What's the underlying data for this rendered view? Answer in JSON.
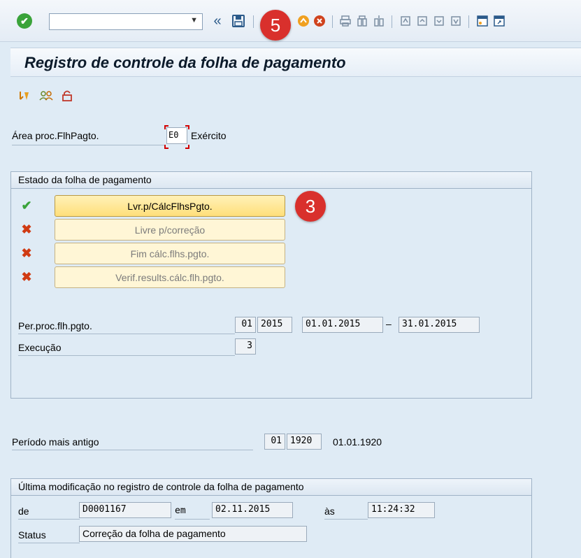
{
  "toolbar": {
    "ok_icon": "✔",
    "command_value": "",
    "dropdown_icon": "▼",
    "back_icon": "«",
    "save_icon": "💾",
    "badge": "5"
  },
  "title": "Registro de controle da folha de pagamento",
  "area": {
    "label": "Área proc.FlhPagto.",
    "value": "E0",
    "text": "Exército"
  },
  "status_group": {
    "title": "Estado da folha de pagamento",
    "badge": "3",
    "buttons": [
      {
        "label": "Lvr.p/CálcFlhsPgto.",
        "state": "ok"
      },
      {
        "label": "Livre p/correção",
        "state": "no"
      },
      {
        "label": "Fim cálc.flhs.pgto.",
        "state": "no"
      },
      {
        "label": "Verif.results.cálc.flh.pgto.",
        "state": "no"
      }
    ],
    "period_label": "Per.proc.flh.pgto.",
    "period_month": "01",
    "period_year": "2015",
    "period_from": "01.01.2015",
    "period_dash": "–",
    "period_to": "31.01.2015",
    "execution_label": "Execução",
    "execution_value": "3"
  },
  "oldest": {
    "label": "Período mais antigo",
    "month": "01",
    "year": "1920",
    "date": "01.01.1920"
  },
  "last_change": {
    "title": "Última modificação no registro de controle da folha de pagamento",
    "de_label": "de",
    "user": "D0001167",
    "em_label": "em",
    "date": "02.11.2015",
    "as_label": "às",
    "time": "11:24:32",
    "status_label": "Status",
    "status_value": "Correção da folha de pagamento"
  },
  "icons": {
    "ok": "✔",
    "no": "✖"
  }
}
